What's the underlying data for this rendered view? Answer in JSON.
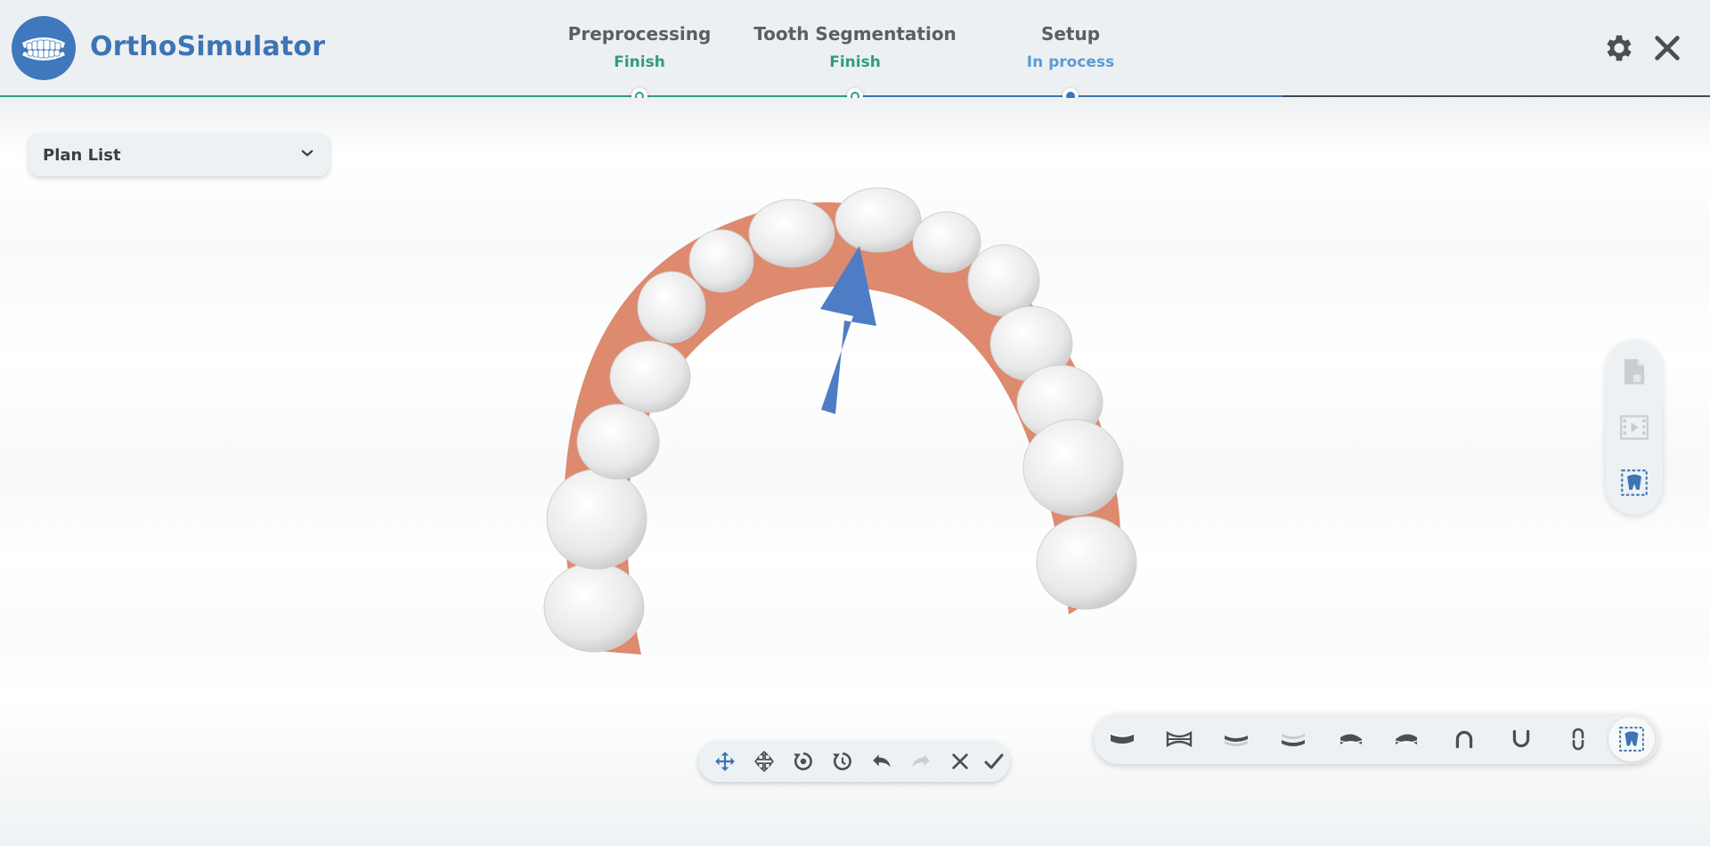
{
  "app": {
    "title": "OrthoSimulator",
    "logo_icon": "teeth-logo-icon",
    "brand_color": "#3f78bd"
  },
  "steps": [
    {
      "name": "Preprocessing",
      "status": "Finish",
      "status_color": "#2e9e7a"
    },
    {
      "name": "Tooth Segmentation",
      "status": "Finish",
      "status_color": "#2e9e7a"
    },
    {
      "name": "Setup",
      "status": "In process",
      "status_color": "#5b9bd5"
    }
  ],
  "header_actions": [
    {
      "icon": "gear-icon"
    },
    {
      "icon": "close-icon"
    }
  ],
  "plan_list": {
    "label": "Plan List",
    "icon": "chevron-down-icon"
  },
  "side_panel": [
    {
      "icon": "save-file-icon"
    },
    {
      "icon": "film-play-icon"
    },
    {
      "icon": "tooth-select-icon"
    }
  ],
  "toolbar": [
    {
      "icon": "move-icon"
    },
    {
      "icon": "pan-icon"
    },
    {
      "icon": "rotate-icon"
    },
    {
      "icon": "rotate-clock-icon"
    },
    {
      "icon": "undo-icon"
    },
    {
      "icon": "redo-icon"
    },
    {
      "icon": "cancel-icon"
    },
    {
      "icon": "confirm-icon"
    }
  ],
  "view_bar": [
    {
      "icon": "view-top-icon"
    },
    {
      "icon": "view-front-icon"
    },
    {
      "icon": "view-upper-icon"
    },
    {
      "icon": "view-lower-icon"
    },
    {
      "icon": "view-left-icon"
    },
    {
      "icon": "view-right-icon"
    },
    {
      "icon": "upper-arch-icon"
    },
    {
      "icon": "lower-arch-icon"
    },
    {
      "icon": "both-arches-icon"
    },
    {
      "icon": "tooth-view-icon"
    }
  ]
}
